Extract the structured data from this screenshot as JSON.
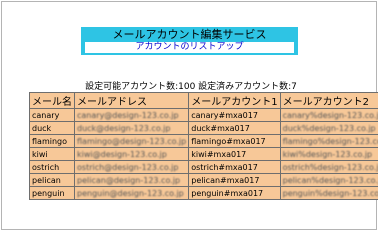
{
  "header": {
    "title": "メールアカウント編集サービス",
    "subtitle": "アカウントのリストアップ"
  },
  "summary": {
    "text": "設定可能アカウント数:100 設定済みアカウント数:7"
  },
  "table": {
    "columns": [
      "メール名",
      "メールアドレス",
      "メールアカウント1",
      "メールアカウント2"
    ],
    "rows": [
      {
        "name": "canary",
        "address": "canary@design-123.co.jp",
        "account1": "canary#mxa017",
        "account2": "canary%design-123.co.jp"
      },
      {
        "name": "duck",
        "address": "duck@design-123.co.jp",
        "account1": "duck#mxa017",
        "account2": "duck%design-123.co.jp"
      },
      {
        "name": "flamingo",
        "address": "flamingo@design-123.co.jp",
        "account1": "flamingo#mxa017",
        "account2": "flamingo%design-123.co.jp"
      },
      {
        "name": "kiwi",
        "address": "kiwi@design-123.co.jp",
        "account1": "kiwi#mxa017",
        "account2": "kiwi%design-123.co.jp"
      },
      {
        "name": "ostrich",
        "address": "ostrich@design-123.co.jp",
        "account1": "ostrich#mxa017",
        "account2": "ostrich%design-123.co.jp"
      },
      {
        "name": "pelican",
        "address": "pelican@design-123.co.jp",
        "account1": "pelican#mxa017",
        "account2": "pelican%design-123.co.jp"
      },
      {
        "name": "penguin",
        "address": "penguin@design-123.co.jp",
        "account1": "penguin#mxa017",
        "account2": "penguin%design-123.co.jp"
      }
    ]
  },
  "colors": {
    "title_bg": "#2ec4e4",
    "table_bg": "#f7c898",
    "link": "#0000cc"
  }
}
